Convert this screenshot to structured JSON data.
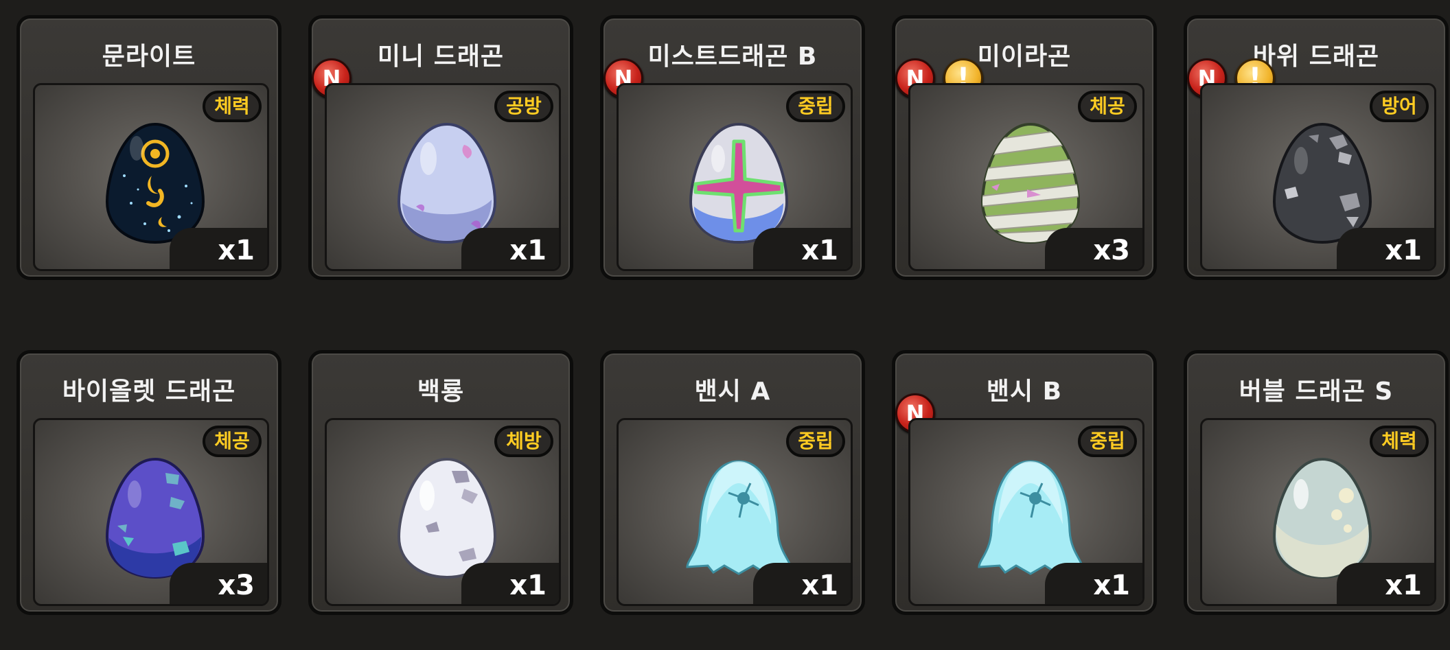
{
  "cards": [
    {
      "name": "문라이트",
      "tag": "체력",
      "count": "x1",
      "egg": "moonlight-egg-icon",
      "new": "",
      "alert": ""
    },
    {
      "name": "미니 드래곤",
      "tag": "공방",
      "count": "x1",
      "egg": "mini-dragon-egg-icon",
      "new": "N",
      "alert": ""
    },
    {
      "name": "미스트드래곤 B",
      "tag": "중립",
      "count": "x1",
      "egg": "mist-dragon-egg-icon",
      "new": "N",
      "alert": ""
    },
    {
      "name": "미이라곤",
      "tag": "체공",
      "count": "x3",
      "egg": "mummy-egg-icon",
      "new": "N",
      "alert": "!"
    },
    {
      "name": "바위 드래곤",
      "tag": "방어",
      "count": "x1",
      "egg": "rock-egg-icon",
      "new": "N",
      "alert": "!"
    },
    {
      "name": "바이올렛 드래곤",
      "tag": "체공",
      "count": "x3",
      "egg": "violet-egg-icon",
      "new": "",
      "alert": ""
    },
    {
      "name": "백룡",
      "tag": "체방",
      "count": "x1",
      "egg": "white-dragon-egg-icon",
      "new": "",
      "alert": ""
    },
    {
      "name": "밴시 A",
      "tag": "중립",
      "count": "x1",
      "egg": "banshee-egg-icon",
      "new": "",
      "alert": ""
    },
    {
      "name": "밴시 B",
      "tag": "중립",
      "count": "x1",
      "egg": "banshee-egg-icon",
      "new": "N",
      "alert": ""
    },
    {
      "name": "버블 드래곤 S",
      "tag": "체력",
      "count": "x1",
      "egg": "bubble-egg-icon",
      "new": "",
      "alert": ""
    }
  ],
  "colors": {
    "tag_text": "#ffcc22",
    "new_badge": "#c8231b",
    "alert_badge": "#f1b32a",
    "background": "#1e1d1b"
  }
}
